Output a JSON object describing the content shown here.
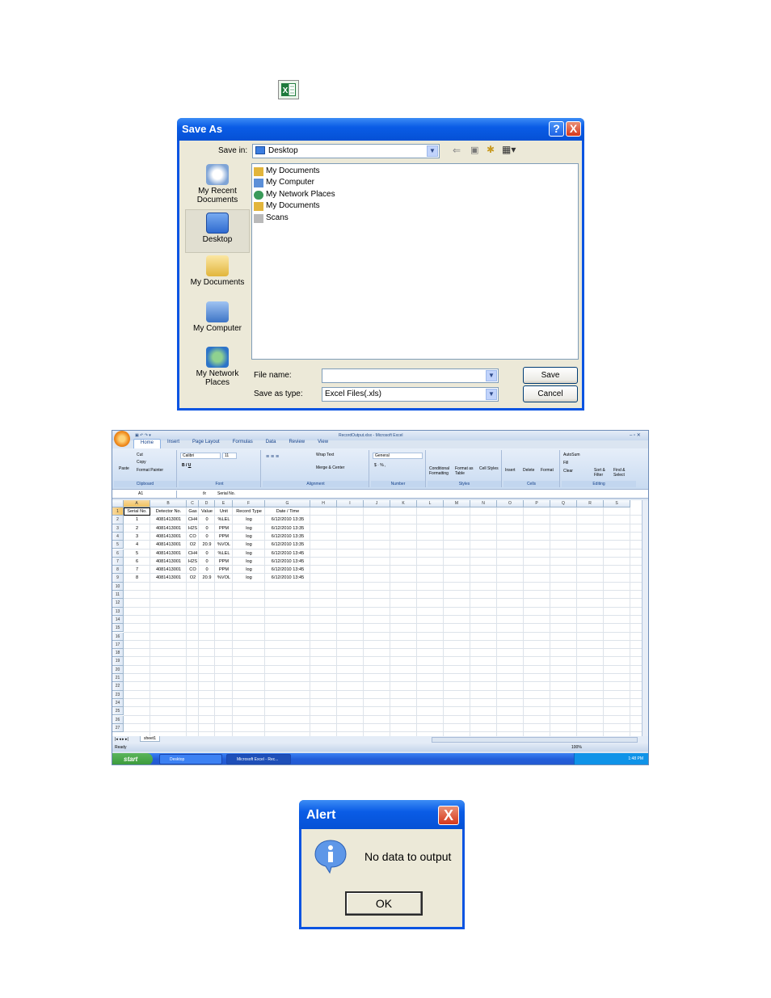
{
  "top_icon": {
    "name": "excel-icon",
    "glyph": "X"
  },
  "saveas": {
    "title": "Save As",
    "help_glyph": "?",
    "close_glyph": "X",
    "save_in_label": "Save in:",
    "save_in_value": "Desktop",
    "places": [
      {
        "label": "My Recent Documents",
        "icon": "recent-documents-icon"
      },
      {
        "label": "Desktop",
        "icon": "desktop-icon"
      },
      {
        "label": "My Documents",
        "icon": "my-documents-icon"
      },
      {
        "label": "My Computer",
        "icon": "my-computer-icon"
      },
      {
        "label": "My Network Places",
        "icon": "network-places-icon"
      }
    ],
    "files": [
      "My Documents",
      "My Computer",
      "My Network Places",
      "My Documents",
      "Scans"
    ],
    "file_name_label": "File name:",
    "file_name_value": "",
    "save_type_label": "Save as type:",
    "save_type_value": "Excel Files(.xls)",
    "save_label": "Save",
    "cancel_label": "Cancel"
  },
  "excel": {
    "window_title": "RecordOutput.xlsx - Microsoft Excel",
    "tabs": [
      "Home",
      "Insert",
      "Page Layout",
      "Formulas",
      "Data",
      "Review",
      "View"
    ],
    "groups": {
      "clipboard": "Clipboard",
      "font": "Font",
      "alignment": "Alignment",
      "number": "Number",
      "styles": "Styles",
      "cells": "Cells",
      "editing": "Editing"
    },
    "ribbon_items": {
      "paste": "Paste",
      "cut": "Cut",
      "copy": "Copy",
      "format_painter": "Format Painter",
      "font_name": "Calibri",
      "font_size": "11",
      "wrap_text": "Wrap Text",
      "merge_center": "Merge & Center",
      "number_format": "General",
      "conditional": "Conditional Formatting",
      "format_table": "Format as Table",
      "cell_styles": "Cell Styles",
      "insert": "Insert",
      "delete": "Delete",
      "format": "Format",
      "autosum": "AutoSum",
      "fill": "Fill",
      "clear": "Clear",
      "sort_filter": "Sort & Filter",
      "find_select": "Find & Select"
    },
    "name_box": "A1",
    "formula_value": "Serial No.",
    "columns": [
      "A",
      "B",
      "C",
      "D",
      "E",
      "F",
      "G",
      "H",
      "I",
      "J",
      "K",
      "L",
      "M",
      "N",
      "O",
      "P",
      "Q",
      "R",
      "S"
    ],
    "header_row": [
      "Serial No.",
      "Detector No.",
      "Gas",
      "Value",
      "Unit",
      "Record Type",
      "Date / Time"
    ],
    "rows": [
      [
        "1",
        "4081413001",
        "CH4",
        "0",
        "%LEL",
        "log",
        "6/12/2010 13:35"
      ],
      [
        "2",
        "4081413001",
        "H2S",
        "0",
        "PPM",
        "log",
        "6/12/2010 13:35"
      ],
      [
        "3",
        "4081413001",
        "CO",
        "0",
        "PPM",
        "log",
        "6/12/2010 13:35"
      ],
      [
        "4",
        "4081413001",
        "O2",
        "20.9",
        "%VOL",
        "log",
        "6/12/2010 13:35"
      ],
      [
        "5",
        "4081413001",
        "CH4",
        "0",
        "%LEL",
        "log",
        "6/12/2010 13:45"
      ],
      [
        "6",
        "4081413001",
        "H2S",
        "0",
        "PPM",
        "log",
        "6/12/2010 13:45"
      ],
      [
        "7",
        "4081413001",
        "CO",
        "0",
        "PPM",
        "log",
        "6/12/2010 13:45"
      ],
      [
        "8",
        "4081413001",
        "O2",
        "20.9",
        "%VOL",
        "log",
        "6/12/2010 13:45"
      ]
    ],
    "row_numbers": [
      "1",
      "2",
      "3",
      "4",
      "5",
      "6",
      "7",
      "8",
      "9",
      "10",
      "11",
      "12",
      "13",
      "14",
      "15",
      "16",
      "17",
      "18",
      "19",
      "20",
      "21",
      "22",
      "23",
      "24",
      "25",
      "26",
      "27"
    ],
    "sheet_tab": "sheet1",
    "status": "Ready",
    "zoom": "100%",
    "taskbar": {
      "start": "start",
      "task1": "Desktop",
      "task2": "Microsoft Excel - Rec...",
      "clock": "1:48 PM"
    }
  },
  "alert": {
    "title": "Alert",
    "close_glyph": "X",
    "message": "No data to output",
    "ok_label": "OK"
  },
  "colors": {
    "xp_blue": "#0a54e2",
    "dialog_bg": "#ece9d8",
    "close_red": "#d6371b",
    "excel_green": "#1e7a3c"
  }
}
